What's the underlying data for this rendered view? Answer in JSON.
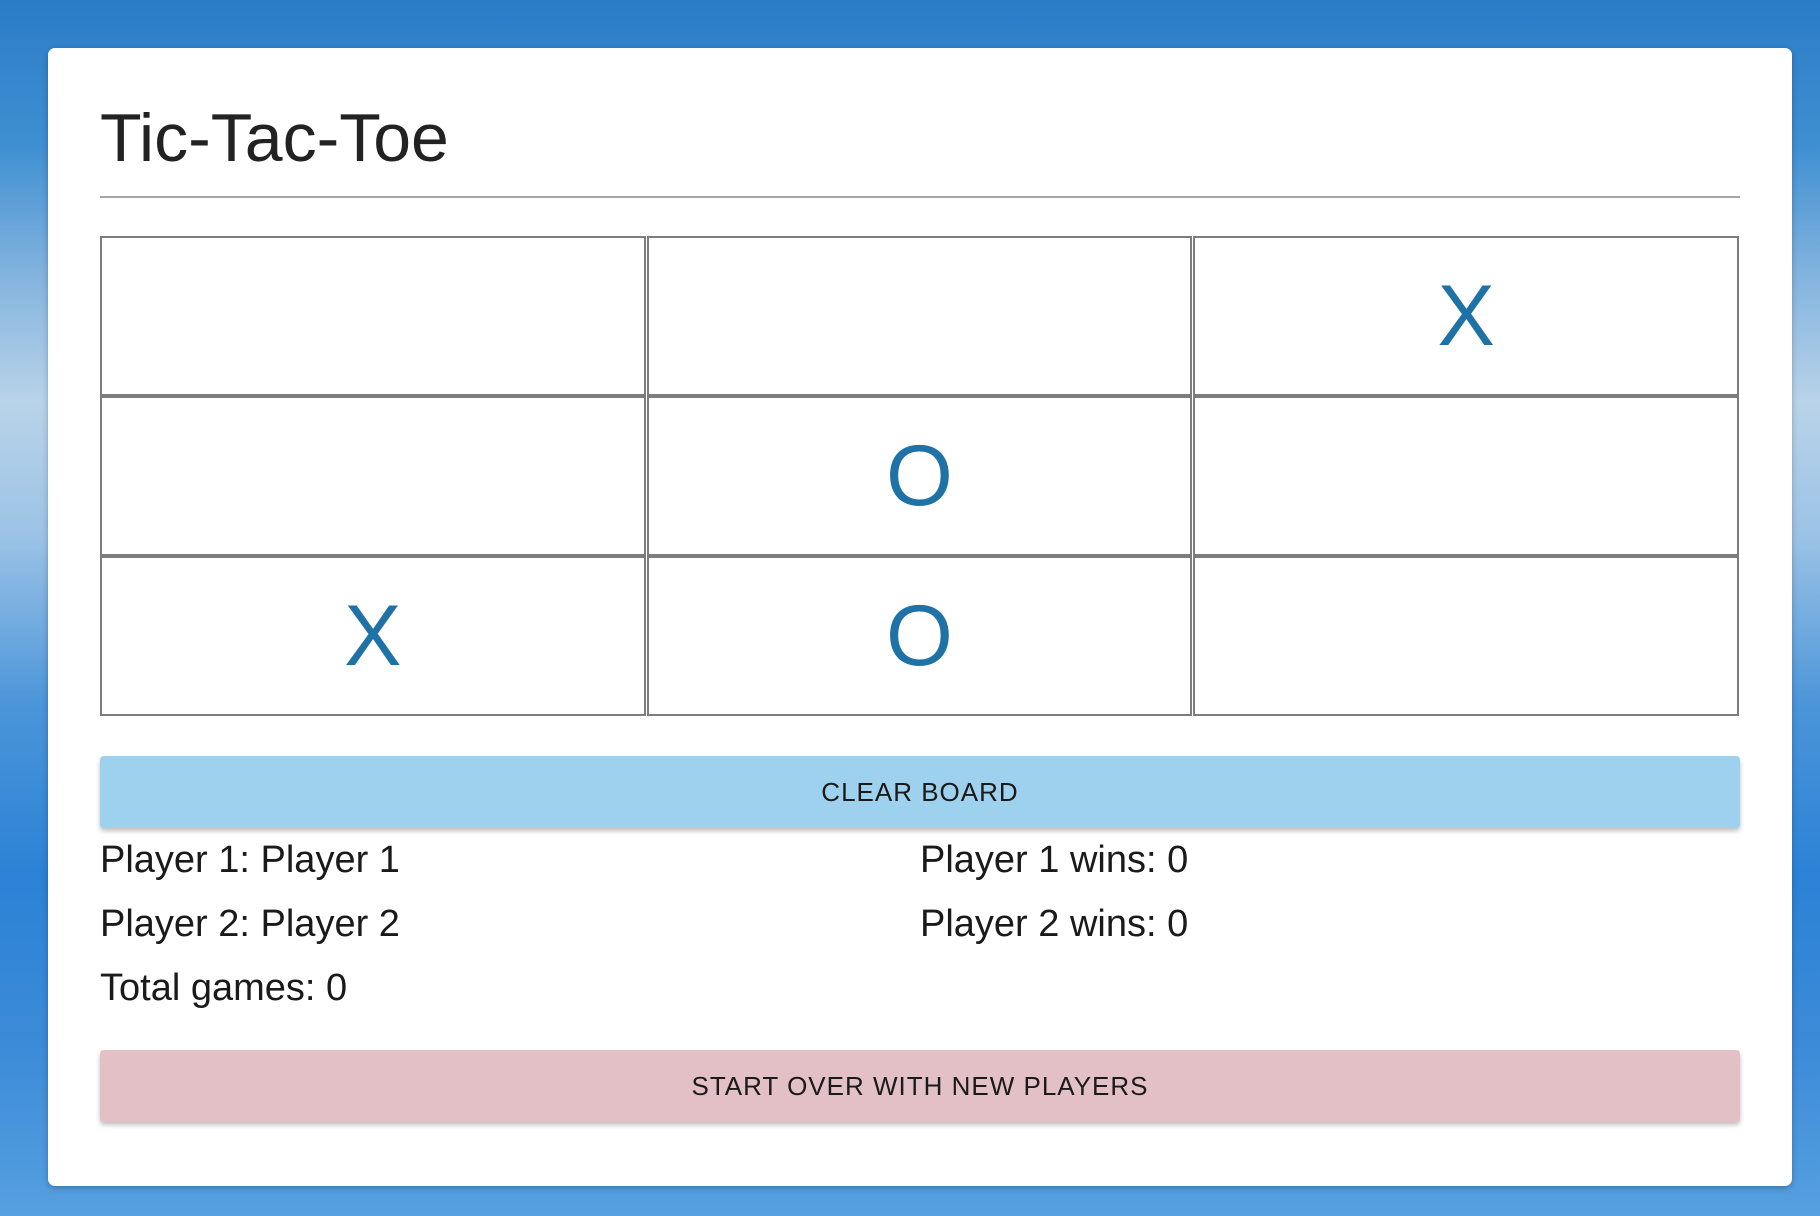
{
  "title": "Tic-Tac-Toe",
  "colors": {
    "mark": "#1e72a6",
    "clear_button": "#9dd1ed",
    "start_button": "#e3bfc6"
  },
  "board": [
    [
      "",
      "",
      "X"
    ],
    [
      "",
      "O",
      ""
    ],
    [
      "X",
      "O",
      ""
    ]
  ],
  "buttons": {
    "clear": "CLEAR BOARD",
    "start_over": "START OVER WITH NEW PLAYERS"
  },
  "stats": {
    "player1": "Player 1: Player 1",
    "player1_wins": "Player 1 wins: 0",
    "player2": "Player 2: Player 2",
    "player2_wins": "Player 2 wins: 0",
    "total_games": "Total games: 0"
  }
}
